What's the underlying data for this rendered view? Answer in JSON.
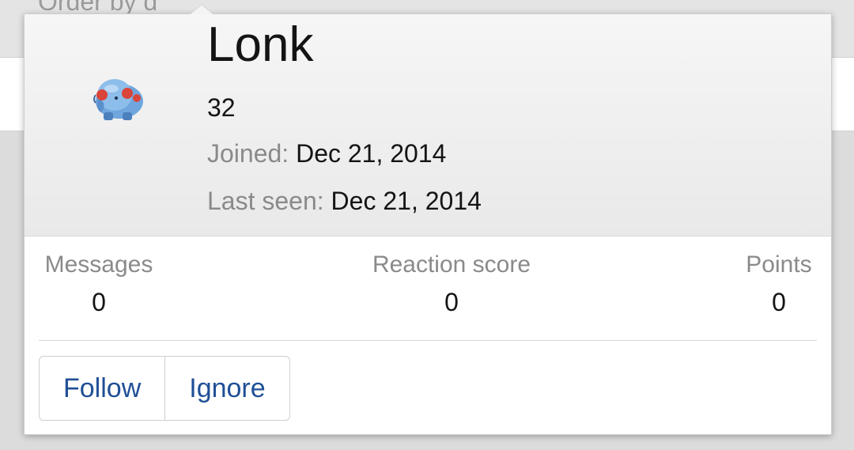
{
  "background": {
    "partial_text": "Order by d"
  },
  "profile": {
    "username": "Lonk",
    "user_title": "32",
    "avatar_icon": "phanpy-sprite-avatar",
    "joined_label": "Joined:",
    "joined_value": "Dec 21, 2014",
    "last_seen_label": "Last seen:",
    "last_seen_value": "Dec 21, 2014"
  },
  "stats": [
    {
      "label": "Messages",
      "value": "0"
    },
    {
      "label": "Reaction score",
      "value": "0"
    },
    {
      "label": "Points",
      "value": "0"
    }
  ],
  "actions": {
    "follow_label": "Follow",
    "ignore_label": "Ignore"
  },
  "colors": {
    "link": "#1f4f96",
    "muted_text": "#8a8a8a",
    "main_text": "#141414"
  }
}
